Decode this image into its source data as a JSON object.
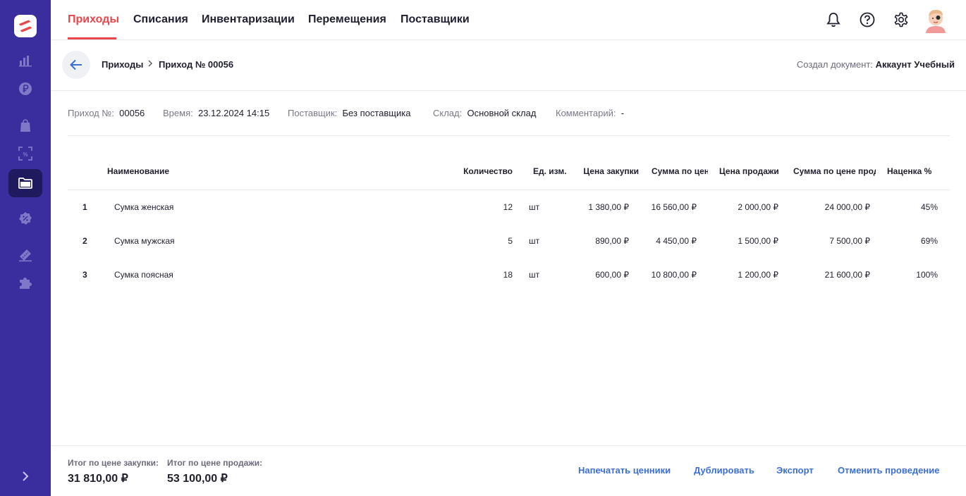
{
  "colors": {
    "sidebar": "#3a2e9e",
    "accent": "#e8474c",
    "link": "#3b6fd4"
  },
  "sidebar": {
    "logo": "app-logo",
    "items": [
      {
        "icon": "chart-bar-icon"
      },
      {
        "icon": "ruble-coin-icon"
      },
      {
        "icon": "shopping-bag-icon"
      },
      {
        "icon": "scan-percent-icon"
      },
      {
        "icon": "folder-icon",
        "active": true
      },
      {
        "icon": "percent-badge-icon"
      },
      {
        "icon": "ticket-icon"
      },
      {
        "icon": "puzzle-icon"
      }
    ],
    "expand_icon": "chevron-right-icon"
  },
  "nav": {
    "tabs": [
      {
        "label": "Приходы",
        "active": true
      },
      {
        "label": "Списания"
      },
      {
        "label": "Инвентаризации"
      },
      {
        "label": "Перемещения"
      },
      {
        "label": "Поставщики"
      }
    ],
    "icons": [
      "bell-icon",
      "help-icon",
      "gear-icon"
    ]
  },
  "header": {
    "breadcrumb_parent": "Приходы",
    "breadcrumb_current": "Приход № 00056",
    "creator_label": "Создал документ:",
    "creator_name": "Аккаунт Учебный"
  },
  "info": {
    "number_label": "Приход №:",
    "number_value": "00056",
    "time_label": "Время:",
    "time_value": "23.12.2024 14:15",
    "supplier_label": "Поставщик:",
    "supplier_value": "Без поставщика",
    "warehouse_label": "Склад:",
    "warehouse_value": "Основной склад",
    "comment_label": "Комментарий:",
    "comment_value": "-"
  },
  "table": {
    "headers": {
      "name": "Наименование",
      "qty": "Количество",
      "unit": "Ед. изм.",
      "buy_price": "Цена закупки",
      "buy_sum": "Сумма по цене закупки",
      "sell_price": "Цена продажи",
      "sell_sum": "Сумма по цене продажи",
      "markup": "Наценка %"
    },
    "rows": [
      {
        "n": "1",
        "name": "Сумка женская",
        "qty": "12",
        "unit": "шт",
        "buy_price": "1 380,00 ₽",
        "buy_sum": "16 560,00 ₽",
        "sell_price": "2 000,00 ₽",
        "sell_sum": "24 000,00 ₽",
        "markup": "45%"
      },
      {
        "n": "2",
        "name": "Сумка мужская",
        "qty": "5",
        "unit": "шт",
        "buy_price": "890,00 ₽",
        "buy_sum": "4 450,00 ₽",
        "sell_price": "1 500,00 ₽",
        "sell_sum": "7 500,00 ₽",
        "markup": "69%"
      },
      {
        "n": "3",
        "name": "Сумка поясная",
        "qty": "18",
        "unit": "шт",
        "buy_price": "600,00 ₽",
        "buy_sum": "10 800,00 ₽",
        "sell_price": "1 200,00 ₽",
        "sell_sum": "21 600,00 ₽",
        "markup": "100%"
      }
    ]
  },
  "footer": {
    "total_buy_label": "Итог по цене закупки:",
    "total_buy_value": "31 810,00 ₽",
    "total_sell_label": "Итог по цене продажи:",
    "total_sell_value": "53 100,00 ₽",
    "actions": {
      "print_tags": "Напечатать ценники",
      "duplicate": "Дублировать",
      "export": "Экспорт",
      "cancel": "Отменить проведение"
    }
  }
}
